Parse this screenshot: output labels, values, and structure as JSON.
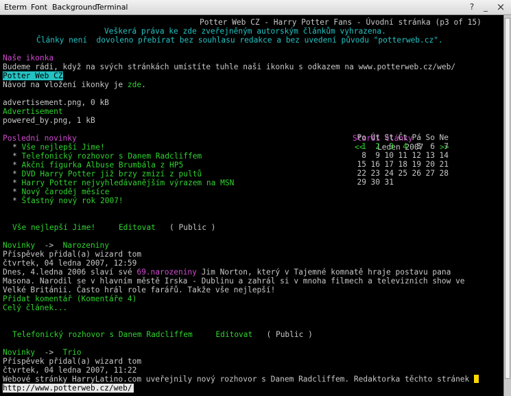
{
  "menubar": {
    "items": [
      "Eterm",
      "Font",
      "Background",
      "Terminal"
    ],
    "help": "?",
    "minimize": "_",
    "close": "×"
  },
  "header": {
    "title": "Potter Web CZ - Harry Potter Fans - Úvodní stránka (p3 of 15)",
    "rights1": "Veškerá práva ke zde zveřejněným autorským článkům vyhrazena.",
    "rights2": "Články není  dovoleno přebírat bez souhlasu redakce a bez uvedení původu \"potterweb.cz\"."
  },
  "icon_section": {
    "heading": "Naše ikonka",
    "text": "Budeme rádi, když na svých stránkách umístíte tuhle naši ikonku s odkazem na www.potterweb.cz/web/",
    "link": "Potter Web CZ",
    "howto_prefix": "Návod na vložení ikonky je ",
    "howto_link": "zde",
    "howto_suffix": ".",
    "file1": "advertisement.png, 0 kB",
    "file1_link": "Advertisement",
    "file2": "powered_by.png, 1 kB"
  },
  "news": {
    "heading": "Poslední novinky",
    "items": [
      "Vše nejlepší Jime!",
      "Telefonický rozhovor s Danem Radcliffem",
      "Akční figurka Albuse Brumbála z HP5",
      "DVD Harry Potter již brzy zmizí z pultů",
      "Harry Potter nejvyhledávanějším výrazem na MSN",
      "Nový čaroděj měsíce",
      "Šťastný nový rok 2007!"
    ]
  },
  "calendar": {
    "heading": "Starší články",
    "prev": "<<",
    "month": "Leden 2007",
    "next": ">>",
    "days": [
      "Po",
      "Út",
      "St",
      "Čt",
      "Pá",
      "So",
      "Ne"
    ],
    "weeks": [
      [
        "1",
        "2",
        "3",
        "4",
        "5",
        "6",
        "7"
      ],
      [
        "8",
        "9",
        "10",
        "11",
        "12",
        "13",
        "14"
      ],
      [
        "15",
        "16",
        "17",
        "18",
        "19",
        "20",
        "21"
      ],
      [
        "22",
        "23",
        "24",
        "25",
        "26",
        "27",
        "28"
      ],
      [
        "29",
        "30",
        "31",
        "",
        "",
        "",
        ""
      ]
    ],
    "linked_days": [
      "1",
      "2",
      "3",
      "4"
    ]
  },
  "article1": {
    "title": "Vše nejlepší Jime!",
    "edit": "Editovat",
    "visibility": "( Public )",
    "cat": "Novinky",
    "arrow": "->",
    "subcat": "Narozeniny",
    "author": "Příspěvek přidal(a) wizard tom",
    "date": "čtvrtek, 04 ledna 2007, 12:59",
    "body1_pre": "Dnes, 4.ledna 2006 slaví své ",
    "body1_num": "69.",
    "body1_link": "narozeniny",
    "body1_post": " Jim Norton, který v Tajemné komnatě hraje postavu pana",
    "body2": "Masona. Narodil se v hlavním městě Irska - Dublinu a zahrál si v mnoha filmech a televizních show ve",
    "body3": "Velké Británii. Často hrál role farářů. Takže vše nejlepší!",
    "comment": "Přidat komentář (Komentáře 4)",
    "full": "Celý článek..."
  },
  "article2": {
    "title": "Telefonický rozhovor s Danem Radcliffem",
    "edit": "Editovat",
    "visibility": "( Public )",
    "cat": "Novinky",
    "arrow": "->",
    "subcat": "Trio",
    "author": "Příspěvek přidal(a) wizard tom",
    "date": "čtvrtek, 04 ledna 2007, 11:22",
    "body1": "Webové stránky HarryLatino.com uveřejnily nový rozhovor s Danem Radcliffem. Redaktorka těchto stránek"
  },
  "status_url": "http://www.potterweb.cz/web/"
}
